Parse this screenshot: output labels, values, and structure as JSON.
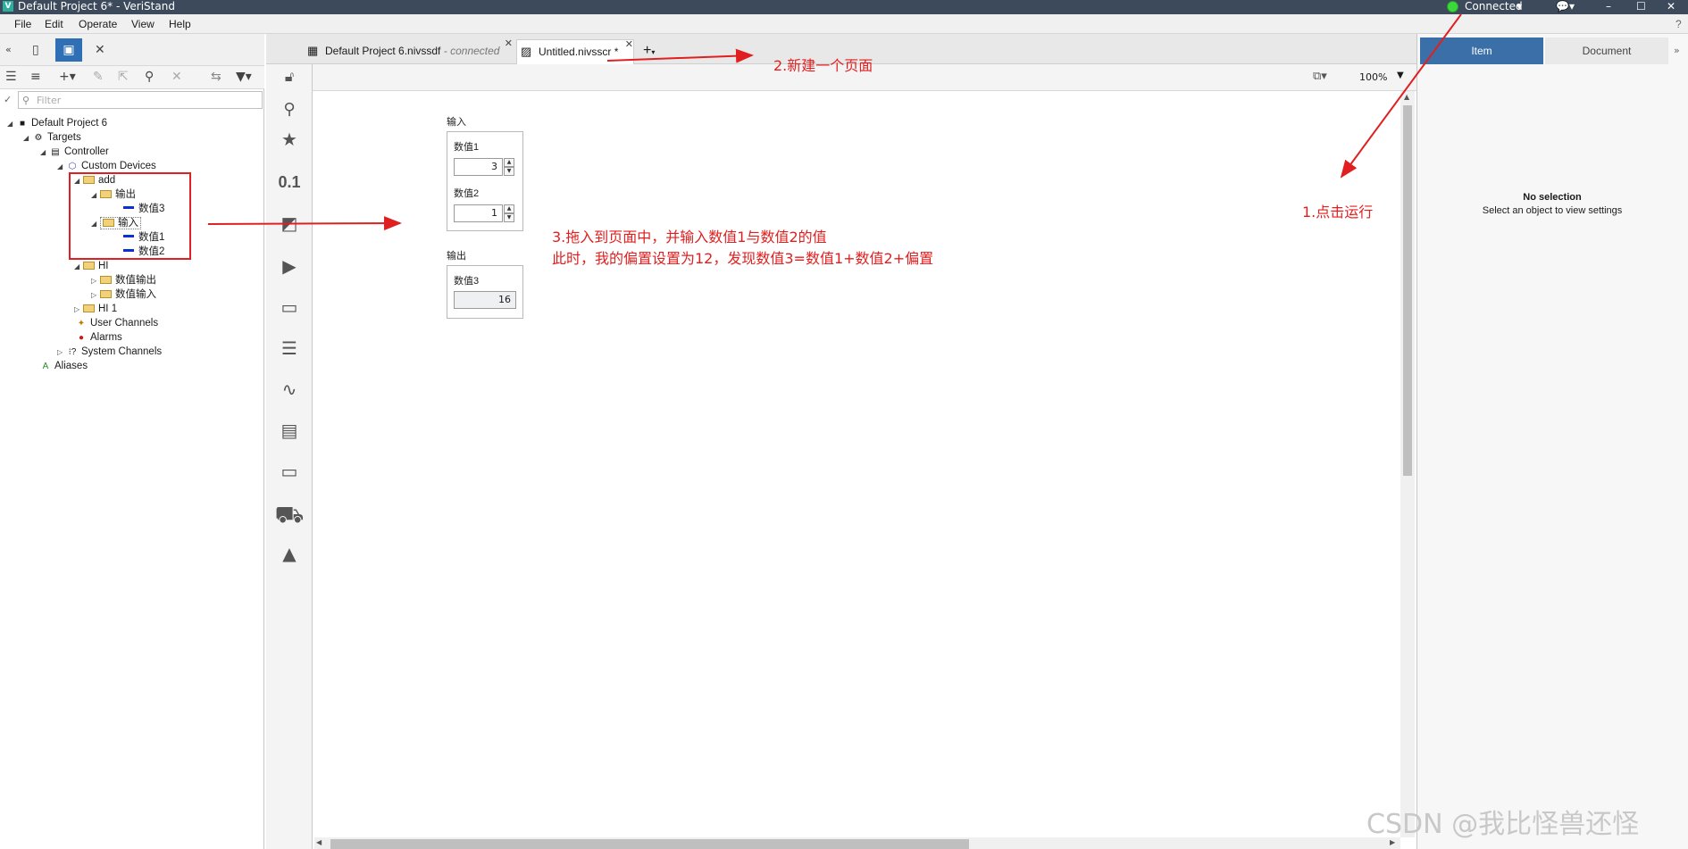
{
  "window": {
    "title": "Default Project 6* - VeriStand",
    "connection": "Connected",
    "logo_letter": "V"
  },
  "menu": {
    "items": [
      "File",
      "Edit",
      "Operate",
      "View",
      "Help"
    ]
  },
  "left_panel": {
    "filter_placeholder": "Filter",
    "tree": [
      {
        "label": "Default Project 6"
      },
      {
        "label": "Targets"
      },
      {
        "label": "Controller"
      },
      {
        "label": "Custom Devices"
      },
      {
        "label": "add"
      },
      {
        "label": "输出"
      },
      {
        "label": "数值3"
      },
      {
        "label": "输入"
      },
      {
        "label": "数值1"
      },
      {
        "label": "数值2"
      },
      {
        "label": "HI"
      },
      {
        "label": "数值输出"
      },
      {
        "label": "数值输入"
      },
      {
        "label": "HI 1"
      },
      {
        "label": "User Channels"
      },
      {
        "label": "Alarms"
      },
      {
        "label": "System Channels"
      },
      {
        "label": "Aliases"
      }
    ]
  },
  "palette": {
    "numeric_label": "0.1",
    "tools": [
      "search-icon",
      "star-icon",
      "numeric-icon",
      "gauge-icon",
      "play-icon",
      "dropdown-icon",
      "text-icon",
      "graph-icon",
      "table-icon",
      "tab-icon",
      "vehicle-icon",
      "shapes-icon"
    ]
  },
  "tabs": [
    {
      "label": "Default Project 6.nivssdf",
      "status": "connected"
    },
    {
      "label": "Untitled.nivsscr *"
    }
  ],
  "doc_toolbar": {
    "zoom": "100%"
  },
  "canvas": {
    "input_group": {
      "title": "输入",
      "fields": [
        {
          "label": "数值1",
          "value": "3"
        },
        {
          "label": "数值2",
          "value": "1"
        }
      ]
    },
    "output_group": {
      "title": "输出",
      "fields": [
        {
          "label": "数值3",
          "value": "16"
        }
      ]
    }
  },
  "right_panel": {
    "tabs": [
      "Item",
      "Document"
    ],
    "empty_title": "No selection",
    "empty_subtitle": "Select an object to view settings"
  },
  "annotations": {
    "step1": "1.点击运行",
    "step2": "2.新建一个页面",
    "step3_line1": "3.拖入到页面中，并输入数值1与数值2的值",
    "step3_line2": "此时，我的偏置设置为12，发现数值3=数值1+数值2+偏置",
    "color": "#e02020"
  },
  "watermark": "CSDN @我比怪兽还怪"
}
